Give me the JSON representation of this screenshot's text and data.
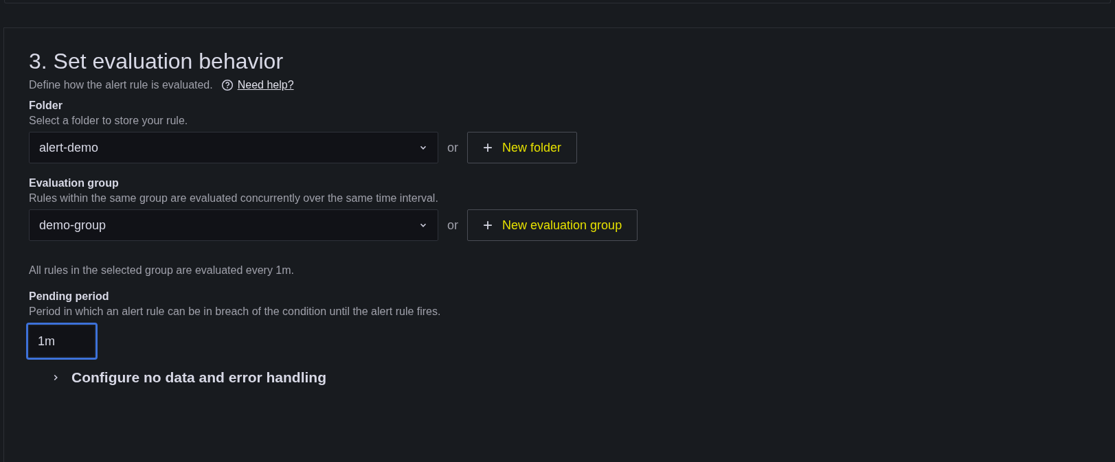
{
  "section": {
    "title": "3. Set evaluation behavior",
    "description": "Define how the alert rule is evaluated.",
    "help_link": "Need help?"
  },
  "fields": [
    {
      "kind": "select",
      "label": "Folder",
      "description": "Select a folder to store your rule.",
      "value": "alert-demo",
      "or": "or",
      "button": {
        "icon": "+",
        "label": "New folder",
        "highlighted": true
      }
    },
    {
      "kind": "select",
      "label": "Evaluation group",
      "description": "Rules within the same group are evaluated concurrently over the same time interval.",
      "value": "demo-group",
      "or": "or",
      "button": {
        "icon": "+",
        "label": "New evaluation group",
        "highlighted": true
      },
      "note": "All rules in the selected group are evaluated every 1m."
    },
    {
      "kind": "input",
      "label": "Pending period",
      "description": "Period in which an alert rule can be in breach of the condition until the alert rule fires.",
      "value": "1m",
      "focused": true
    }
  ],
  "collapsible": {
    "label": "Configure no data and error handling",
    "expanded": false
  }
}
